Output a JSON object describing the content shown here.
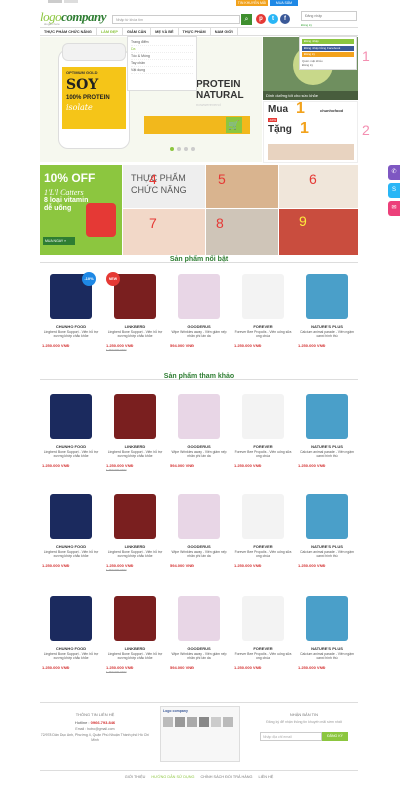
{
  "header": {
    "logo_a": "logo",
    "logo_b": "company",
    "logo_sub": "slogan here",
    "search_placeholder": "Nhập từ khóa tìm",
    "top_buttons": [
      "TIN KHUYẾN MÃI",
      "MUA SẮM"
    ],
    "login_placeholder": "Đăng nhập",
    "register_label": "Đăng ký"
  },
  "nav": {
    "items": [
      "THỰC PHẨM CHỨC NĂNG",
      "LÀM ĐẸP",
      "GIẢM CÂN",
      "MẸ VÀ BÉ",
      "THỰC PHẨM",
      "NAM GIỚI"
    ]
  },
  "dropdown": {
    "items": [
      "Trang điểm",
      "Da",
      "Tóc & Móng",
      "Tay chân",
      "Vật dụng"
    ]
  },
  "account": {
    "buttons": [
      "Đăng nhập",
      "Đăng nhập bằng Facebook",
      "Đăng ký"
    ],
    "help_text": "Quên mật khẩu",
    "lines": [
      "Đăng ký"
    ]
  },
  "banner": {
    "jar_l1": "OPTIMUM GOLD",
    "jar_l2": "SOY",
    "jar_l3": "100% PROTEIN",
    "jar_l4": "isolate",
    "title1": "PROTEIN",
    "title2": "NATURAL",
    "title3": "nowwerevend",
    "cart_icon": "cart-icon"
  },
  "promos": {
    "promo1_caption": "Dinh dưỡng tốt cho sức khỏe",
    "promo2_mua": "Mua",
    "promo2_tang": "Tặng",
    "promo2_n": "1",
    "promo2_brand": "chunhofood",
    "promo2_pct": "-10%",
    "labels": [
      "1",
      "2"
    ]
  },
  "grid": {
    "off_big": "10% OFF",
    "off_t2": "1'L'l Catters",
    "off_t3": "8 loại vitamin",
    "off_t4": "dễ uống",
    "off_btn": "MUA NGAY »",
    "thuc_t1": "THỰC PHẨM",
    "thuc_t2": "CHỨC NĂNG",
    "numbers": [
      "4",
      "5",
      "6",
      "7",
      "8",
      "9"
    ]
  },
  "sections": {
    "featured": "Sản phẩm nổi bật",
    "reference": "Sản phẩm tham khảo"
  },
  "products": [
    {
      "brand": "CHUNHO FOOD",
      "name": "Lingberd Bone Support - Viên hỗ trợ xương khớp chắc khỏe",
      "price": "1.250.000 VNĐ",
      "badge": "-10%",
      "color": "#1b2a5e"
    },
    {
      "brand": "LINKBERD",
      "name": "Lingberd Bone Support - Viên hỗ trợ xương khớp chắc khỏe",
      "price": "1.250.000 VNĐ",
      "old": "1.450.000 VNĐ",
      "new": "NEW",
      "color": "#7a1f1f"
    },
    {
      "brand": "GOODERUS",
      "name": "Wipe Wrinkles away - Viên giảm nếp nhăn phí lán da",
      "price": "594.000 VNĐ",
      "color": "#e8d6e6"
    },
    {
      "brand": "FOREVER",
      "name": "Forever Bee Propolis - Viên uống sữa ong chúa",
      "price": "1.250.000 VNĐ",
      "color": "#f3f3f3"
    },
    {
      "brand": "NATURE'S PLUS",
      "name": "Calcium animal parade - Viên ngậm canxi hình thú",
      "price": "1.250.000 VNĐ",
      "color": "#4a9fc9"
    }
  ],
  "ref_products": [
    {
      "brand": "CHUNHO FOOD",
      "name": "Lingberd Bone Support - Viên hỗ trợ xương khớp chắc khỏe",
      "price": "1.250.000 VNĐ",
      "color": "#1b2a5e"
    },
    {
      "brand": "LINKBERD",
      "name": "Lingberd Bone Support - Viên hỗ trợ xương khớp chắc khỏe",
      "price": "1.250.000 VNĐ",
      "old": "1.450.000 VNĐ",
      "color": "#7a1f1f"
    },
    {
      "brand": "GOODERUS",
      "name": "Wipe Wrinkles away - Viên giảm nếp nhăn phí lán da",
      "price": "594.000 VNĐ",
      "color": "#e8d6e6"
    },
    {
      "brand": "FOREVER",
      "name": "Forever Bee Propolis - Viên uống sữa ong chúa",
      "price": "1.250.000 VNĐ",
      "color": "#f3f3f3"
    },
    {
      "brand": "NATURE'S PLUS",
      "name": "Calcium animal parade - Viên ngậm canxi hình thú",
      "price": "1.250.000 VNĐ",
      "color": "#4a9fc9"
    }
  ],
  "footer": {
    "contact_title": "THÔNG TIN LIÊN HỆ",
    "hotline_label": "Hotline :",
    "hotline": "0966.793.846",
    "email": "Email : hotro@gmail.com",
    "address": "72/978 Dân Dục Anh, Phường 4, Quận Phú Nhuận Thành phố Hồ Chí Minh",
    "news_title": "NHẬN BẢN TIN",
    "news_text": "Đăng ký để nhận thông tin khuyến mãi sớm nhất",
    "email_placeholder": "Nhập địa chỉ email",
    "subscribe": "ĐĂNG KÝ",
    "fb_title": "Logo company",
    "links": [
      "GIỚI THIỆU",
      "HƯỚNG DẪN SỬ DỤNG",
      "CHÍNH SÁCH ĐỔI TRẢ HÀNG",
      "LIÊN HỆ"
    ]
  },
  "colors": {
    "brand_green": "#8cc63f",
    "dark_green": "#2e7d32",
    "price_red": "#d32f2f",
    "orange": "#f2a21c",
    "blue": "#1e88e5"
  }
}
